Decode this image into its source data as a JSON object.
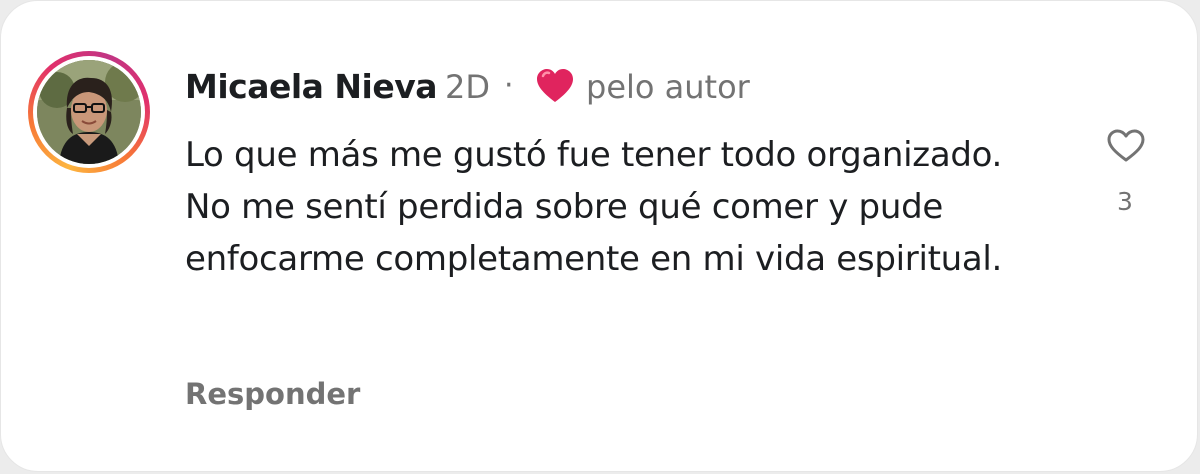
{
  "comment": {
    "author": "Micaela Nieva",
    "time": "2D",
    "separator": "·",
    "liked_by_author_label": "pelo autor",
    "text": "Lo que más me gustó fue tener todo organizado. No me sentí perdida sobre qué comer y pude enfocarme completamente en mi vida espiritual.",
    "reply_label": "Responder",
    "like_count": "3"
  },
  "icons": {
    "author_heart": "red-heart-emoji",
    "like": "heart-outline-icon",
    "avatar": "user-avatar-photo"
  },
  "colors": {
    "name": "#1c1e21",
    "secondary": "#737373",
    "heart": "#e0245e",
    "ring_start": "#fdb53f",
    "ring_end": "#c13584"
  }
}
